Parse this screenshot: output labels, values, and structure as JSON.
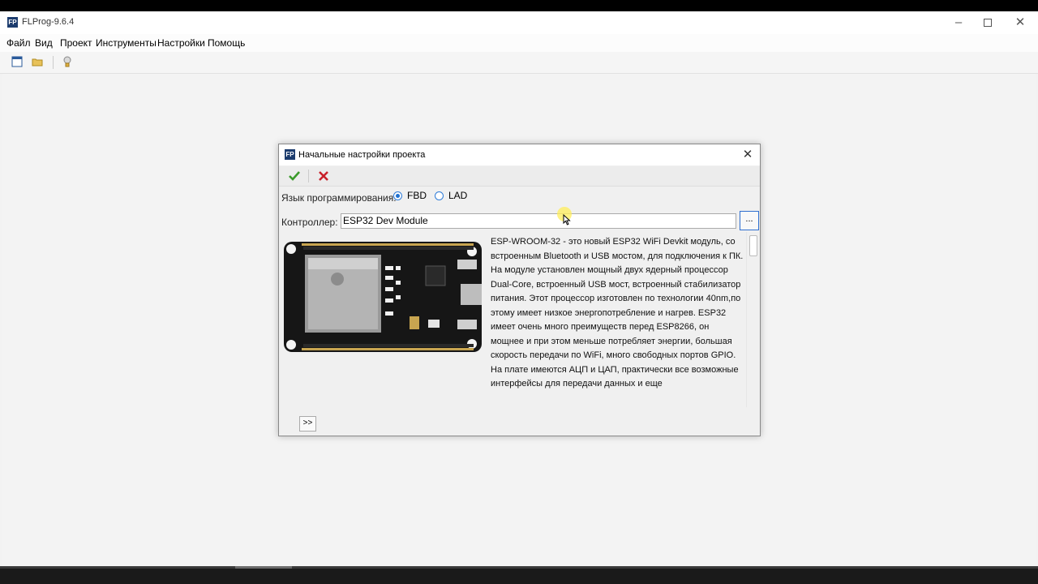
{
  "app": {
    "title": "FLProg-9.6.4",
    "menu": [
      "Файл",
      "Вид",
      "Проект",
      "Инструменты",
      "Настройки",
      "Помощь"
    ]
  },
  "dialog": {
    "title": "Начальные настройки проекта",
    "language_label": "Язык программирования:",
    "languages": [
      {
        "label": "FBD",
        "selected": true
      },
      {
        "label": "LAD",
        "selected": false
      }
    ],
    "controller_label": "Контроллер:",
    "controller_value": "ESP32 Dev Module",
    "browse_label": "...",
    "next_label": ">>",
    "description": "ESP-WROOM-32 - это новый ESP32 WiFi Devkit модуль, со встроенным Bluetooth и USB мостом, для подключения к ПК. На модуле установлен мощный двух ядерный процессор Dual-Core, встроенный USB мост, встроенный стабилизатор питания. Этот процессор изготовлен по технологии 40nm,по этому имеет низкое энергопотребление и нагрев. ESP32 имеет очень много преимуществ перед ESP8266, он мощнее и при этом меньше потребляет энергии, большая скорость передачи по WiFi, много свободных портов GPIO. На плате имеются АЦП и ЦАП, практически все возможные интерфейсы для передачи данных и еще"
  },
  "colors": {
    "accept": "#3a9a2a",
    "cancel": "#c8202a",
    "accent": "#2f7cd8"
  }
}
